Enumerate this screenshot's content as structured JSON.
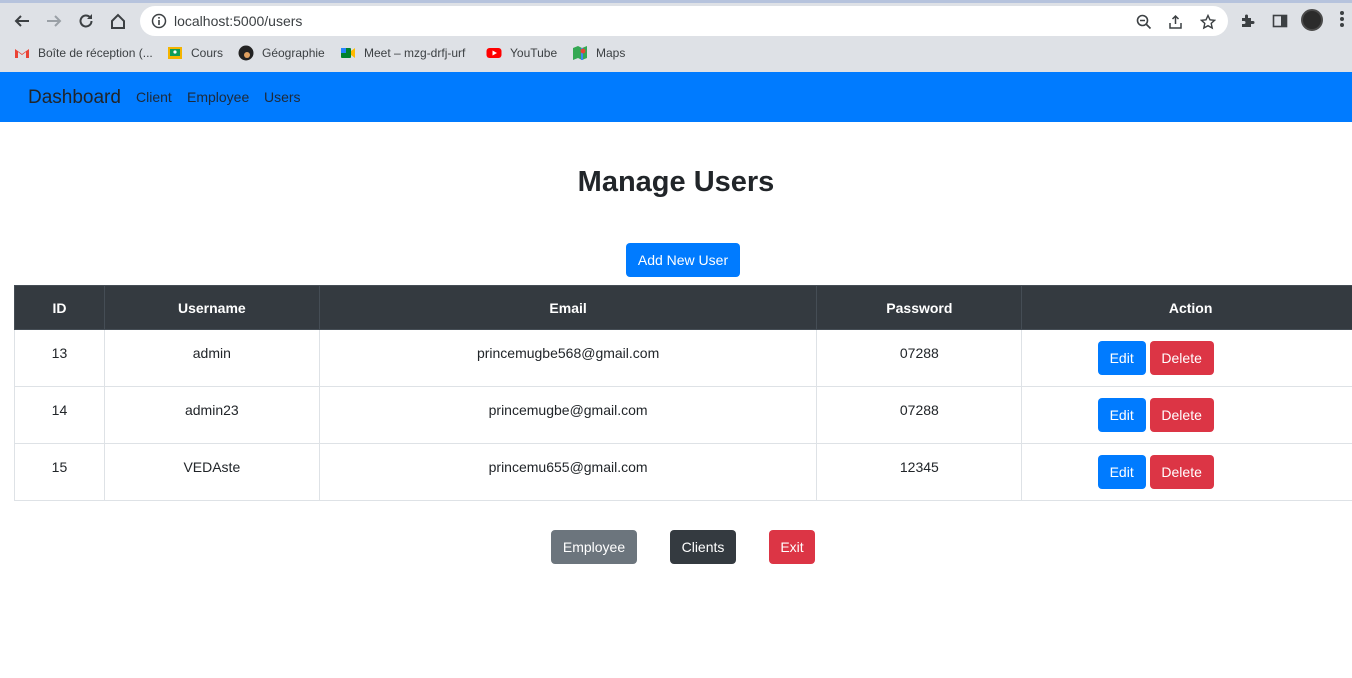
{
  "browser": {
    "url": "localhost:5000/users",
    "bookmarks": [
      {
        "label": "Boîte de réception (...",
        "icon": "gmail-icon",
        "color": "#ea4335"
      },
      {
        "label": "Cours",
        "icon": "classroom-icon",
        "color": "#f4b400"
      },
      {
        "label": "Géographie",
        "icon": "avatar-icon",
        "color": "#222222"
      },
      {
        "label": "Meet – mzg-drfj-urf",
        "icon": "meet-icon",
        "color": "#00832d"
      },
      {
        "label": "YouTube",
        "icon": "youtube-icon",
        "color": "#ff0000"
      },
      {
        "label": "Maps",
        "icon": "maps-icon",
        "color": "#34a853"
      }
    ]
  },
  "navbar": {
    "brand": "Dashboard",
    "links": [
      "Client",
      "Employee",
      "Users"
    ],
    "color": "#007bff"
  },
  "page": {
    "title": "Manage Users",
    "add_button": "Add New User"
  },
  "table": {
    "headers": [
      "ID",
      "Username",
      "Email",
      "Password",
      "Action"
    ],
    "rows": [
      {
        "id": "13",
        "username": "admin",
        "email": "princemugbe568@gmail.com",
        "password": "07288"
      },
      {
        "id": "14",
        "username": "admin23",
        "email": "princemugbe@gmail.com",
        "password": "07288"
      },
      {
        "id": "15",
        "username": "VEDAste",
        "email": "princemu655@gmail.com",
        "password": "12345"
      }
    ],
    "edit_label": "Edit",
    "delete_label": "Delete"
  },
  "footer_buttons": {
    "employee": "Employee",
    "clients": "Clients",
    "exit": "Exit"
  }
}
